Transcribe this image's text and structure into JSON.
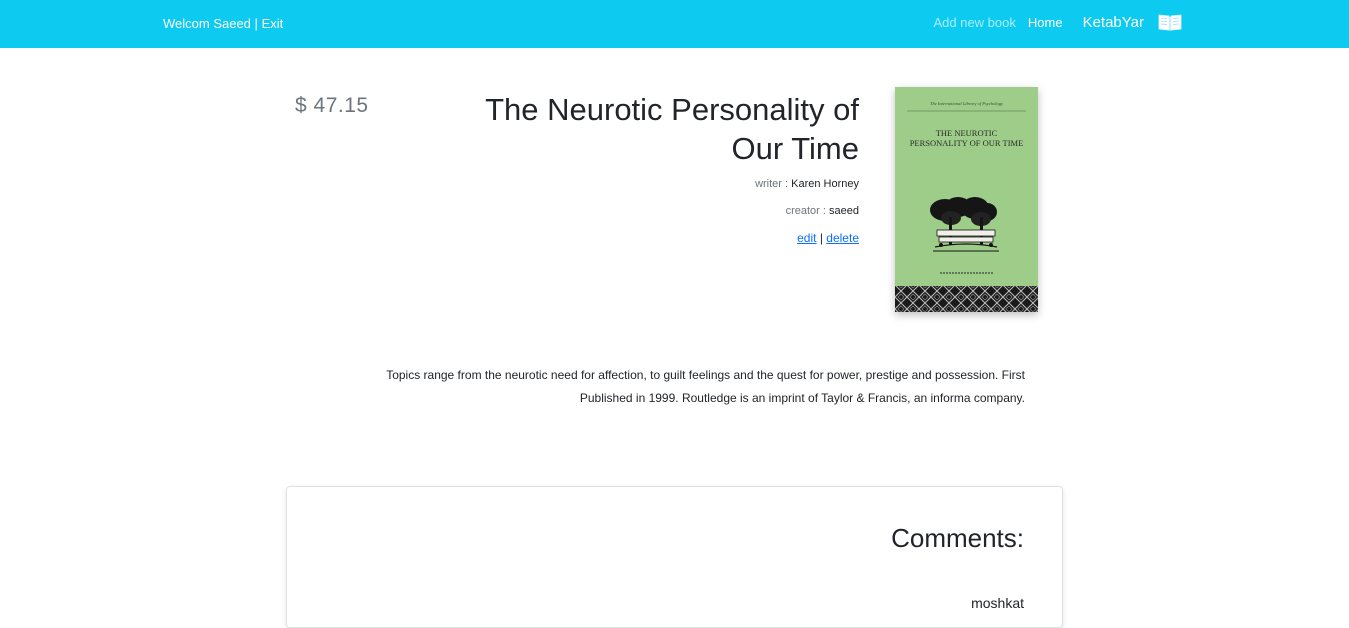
{
  "navbar": {
    "welcome": "Welcom Saeed",
    "separator": "|",
    "exit": "Exit",
    "add_new_book": "Add new book",
    "home": "Home",
    "brand": "KetabYar",
    "brand_icon": "open-book-icon"
  },
  "book": {
    "price": "$ 47.15",
    "title": "The Neurotic Personality of Our Time",
    "writer_label": "writer :",
    "writer": "Karen Horney",
    "creator_label": "creator :",
    "creator": "saeed",
    "edit": "edit",
    "action_separator": "|",
    "delete": "delete",
    "cover": {
      "series": "The International Library of Psychology",
      "title_line1": "THE NEUROTIC",
      "title_line2": "PERSONALITY OF OUR TIME",
      "colors": {
        "background": "#9dcd89",
        "pattern": "#1a1a1a"
      }
    },
    "description": "Topics range from the neurotic need for affection, to guilt feelings and the quest for power, prestige and possession. First Published in 1999. Routledge is an imprint of Taylor & Francis, an informa company."
  },
  "comments": {
    "title": "Comments:",
    "items": [
      {
        "user": "moshkat"
      }
    ]
  },
  "colors": {
    "navbar": "#0dcaf0",
    "link": "#0d6efd",
    "muted": "#6c757d"
  }
}
